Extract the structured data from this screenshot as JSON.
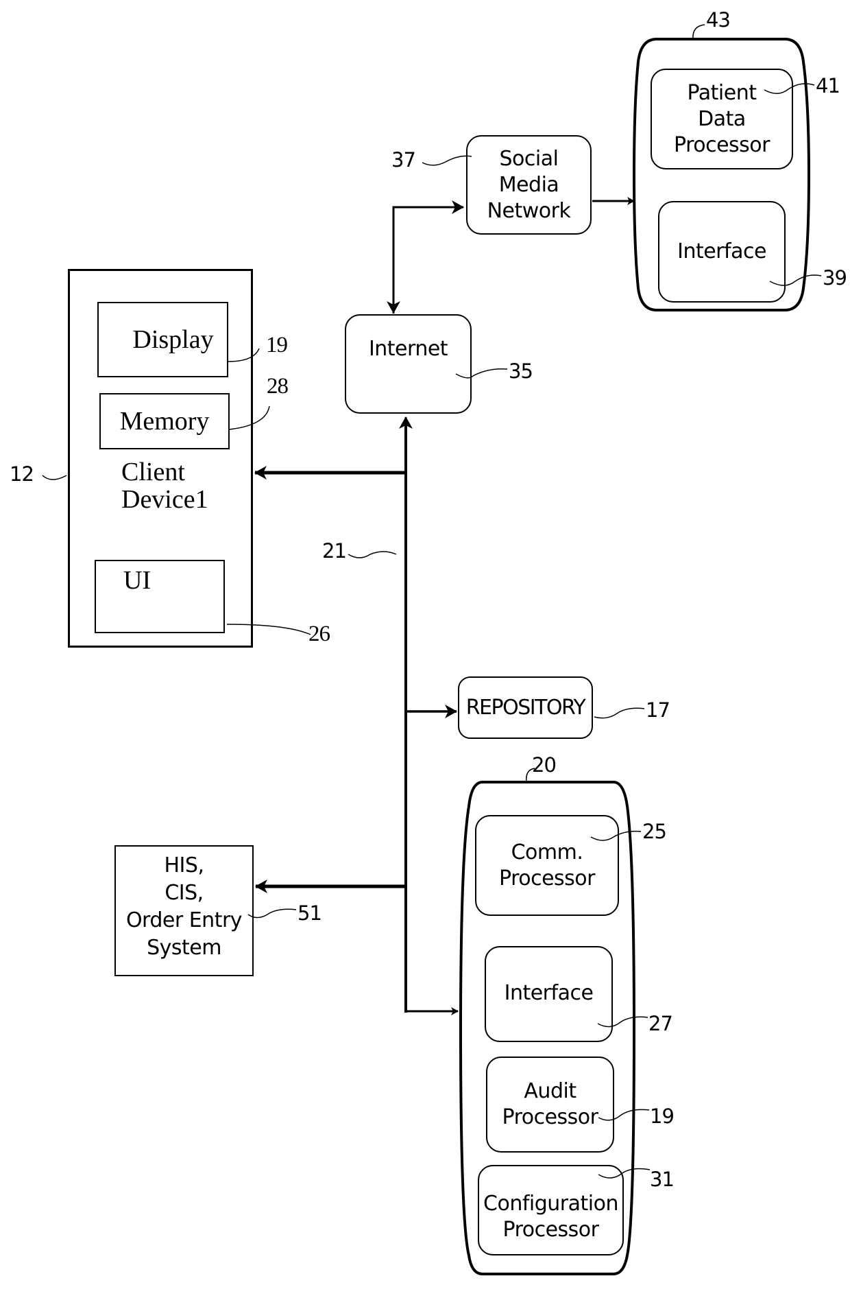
{
  "figure": {
    "client_device": {
      "ref": "12",
      "title_line1": "Client",
      "title_line2": "Device1",
      "display": {
        "label": "Display",
        "ref": "19"
      },
      "memory": {
        "label": "Memory",
        "ref": "28"
      },
      "ui": {
        "label": "UI",
        "ref": "26"
      }
    },
    "network_bus": {
      "ref": "21"
    },
    "internet": {
      "label": "Internet",
      "ref": "35"
    },
    "social_media": {
      "label_line1": "Social Media",
      "label_line2": "Network",
      "ref": "37"
    },
    "patient_system": {
      "ref": "43",
      "patient_data_processor": {
        "line1": "Patient",
        "line2": "Data",
        "line3": "Processor",
        "ref": "41"
      },
      "interface": {
        "label": "Interface",
        "ref": "39"
      }
    },
    "repository": {
      "label": "REPOSITORY",
      "ref": "17"
    },
    "server": {
      "ref": "20",
      "comm_processor": {
        "line1": "Comm.",
        "line2": "Processor",
        "ref": "25"
      },
      "interface": {
        "label": "Interface",
        "ref": "27"
      },
      "audit_processor": {
        "line1": "Audit",
        "line2": "Processor",
        "ref": "19"
      },
      "configuration_processor": {
        "line1": "Configuration",
        "line2": "Processor",
        "ref": "31"
      }
    },
    "his_system": {
      "line1": "HIS,",
      "line2": "CIS,",
      "line3": "Order Entry",
      "line4": "System",
      "ref": "51"
    }
  }
}
